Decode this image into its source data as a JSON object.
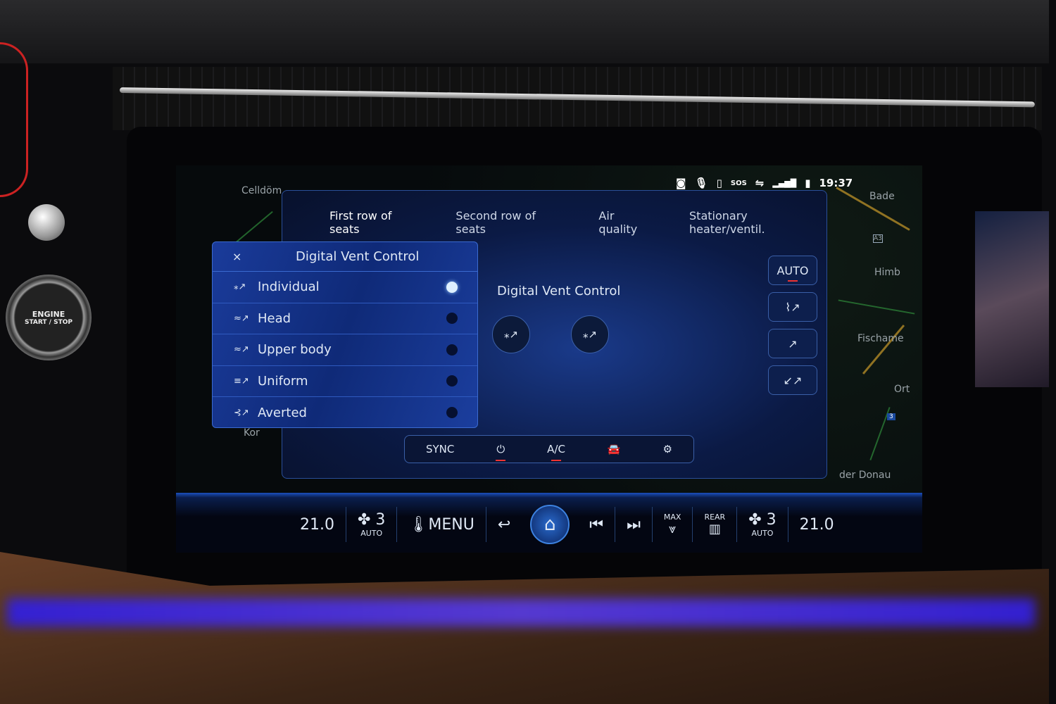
{
  "status_bar": {
    "icons": [
      "camera-icon",
      "microphone-icon",
      "phone-icon",
      "sos-icon",
      "connectivity-icon",
      "signal-icon",
      "battery-icon"
    ],
    "time": "19:37"
  },
  "map": {
    "labels": [
      "Celldöm",
      "Kor",
      "Bade",
      "Himb",
      "Fischame",
      "Ort",
      "der Donau",
      "A3",
      "3"
    ]
  },
  "tabs": [
    {
      "label": "First row of seats",
      "active": true
    },
    {
      "label": "Second row of seats"
    },
    {
      "label": "Air quality"
    },
    {
      "label": "Stationary heater/ventil."
    }
  ],
  "main": {
    "title": "Digital Vent Control",
    "auto_label": "AUTO"
  },
  "dropdown": {
    "title": "Digital Vent Control",
    "close": "×",
    "items": [
      {
        "label": "Individual",
        "selected": true
      },
      {
        "label": "Head",
        "selected": false
      },
      {
        "label": "Upper body",
        "selected": false
      },
      {
        "label": "Uniform",
        "selected": false
      },
      {
        "label": "Averted",
        "selected": false
      }
    ]
  },
  "bottom_controls": {
    "sync": "SYNC",
    "ac": "A/C"
  },
  "climate_bar": {
    "left_temp": "21.0",
    "left_fan": "3",
    "left_fan_mode": "AUTO",
    "menu": "MENU",
    "max_label": "MAX",
    "rear_label": "REAR",
    "right_fan": "3",
    "right_fan_mode": "AUTO",
    "right_temp": "21.0"
  },
  "engine_button": {
    "line1": "ENGINE",
    "line2": "START / STOP"
  },
  "colors": {
    "accent": "#3f8cff",
    "indicator": "#e33333",
    "panel": "#0f2a78"
  }
}
